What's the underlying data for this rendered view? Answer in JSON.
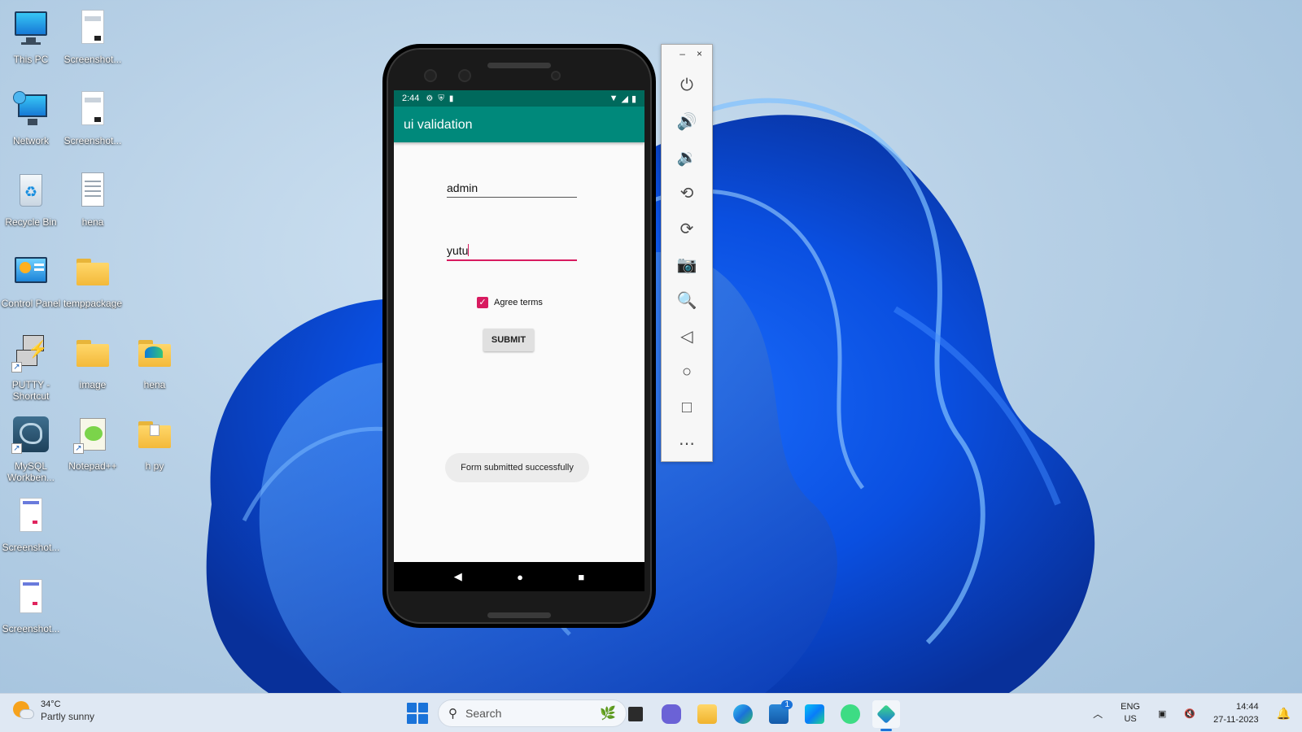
{
  "desktop": {
    "icons": [
      {
        "label": "This PC",
        "icon": "monitor-icon"
      },
      {
        "label": "Screenshot...",
        "icon": "image-file-icon"
      },
      {
        "label": "Network",
        "icon": "network-icon"
      },
      {
        "label": "Screenshot...",
        "icon": "image-file-icon"
      },
      {
        "label": "Recycle Bin",
        "icon": "recycle-bin-icon"
      },
      {
        "label": "hena",
        "icon": "text-file-icon"
      },
      {
        "label": "Control Panel",
        "icon": "control-panel-icon"
      },
      {
        "label": "temppackage",
        "icon": "folder-icon"
      },
      {
        "label": "PUTTY - Shortcut",
        "icon": "putty-icon"
      },
      {
        "label": "image",
        "icon": "folder-icon"
      },
      {
        "label": "hena",
        "icon": "folder-icon"
      },
      {
        "label": "MySQL Workben...",
        "icon": "mysql-workbench-icon"
      },
      {
        "label": "Notepad++",
        "icon": "notepadpp-icon"
      },
      {
        "label": "h py",
        "icon": "folder-icon"
      },
      {
        "label": "Screenshot...",
        "icon": "image-file-icon"
      },
      {
        "label": "Screenshot...",
        "icon": "image-file-icon"
      }
    ]
  },
  "phone": {
    "status_time": "2:44",
    "app_title": "ui validation",
    "username_value": "admin",
    "password_value": "yutu",
    "agree_label": "Agree terms",
    "agree_checked": true,
    "submit_label": "SUBMIT",
    "toast": "Form submitted successfully"
  },
  "emulator_panel": {
    "minimize": "–",
    "close": "×",
    "buttons": [
      "power-icon",
      "volume-up-icon",
      "volume-down-icon",
      "rotate-left-icon",
      "rotate-right-icon",
      "camera-icon",
      "zoom-icon",
      "back-icon",
      "home-icon",
      "overview-icon",
      "more-icon"
    ]
  },
  "taskbar": {
    "weather_temp": "34°C",
    "weather_cond": "Partly sunny",
    "search_placeholder": "Search",
    "lang_top": "ENG",
    "lang_bottom": "US",
    "time": "14:44",
    "date": "27-11-2023",
    "store_badge": "1"
  },
  "colors": {
    "app_bar": "#00897b",
    "status_bar": "#00695c",
    "accent": "#d81b60"
  }
}
